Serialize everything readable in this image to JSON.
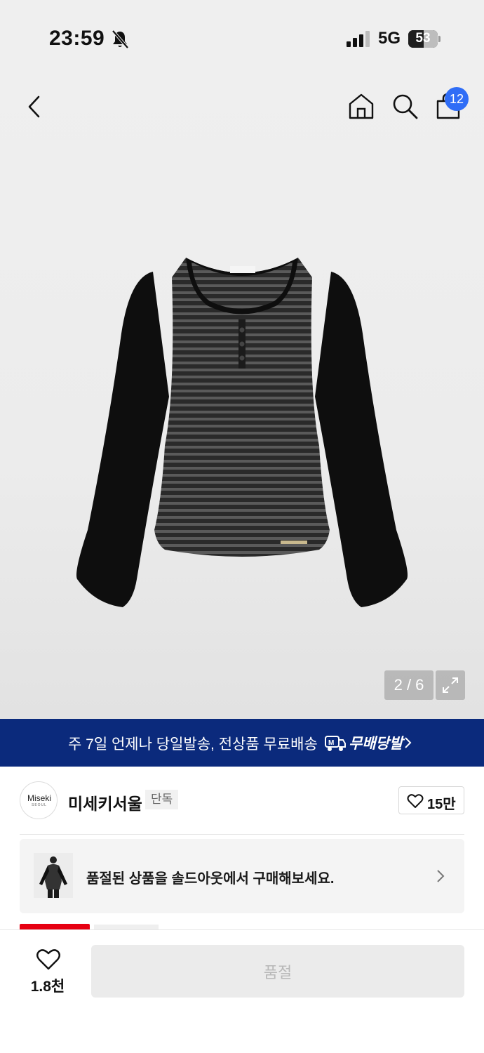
{
  "status_bar": {
    "time": "23:59",
    "network": "5G",
    "battery_level": 53,
    "battery_text": "53"
  },
  "nav": {
    "cart_count": "12"
  },
  "gallery": {
    "counter": "2 / 6",
    "current_image": 2,
    "total_images": 6
  },
  "promo": {
    "text": "주 7일 언제나 당일발송, 전상품 무료배송",
    "brand": "무배당발"
  },
  "brand": {
    "logo_text": "Miseki",
    "logo_subtext": "SEOUL",
    "name": "미세키서울",
    "exclusive_label": "단독",
    "like_count": "15만"
  },
  "soldout_card": {
    "text": "품절된 상품을 솔드아웃에서 구매해보세요."
  },
  "bottom_bar": {
    "like_count": "1.8천",
    "action_label": "품절"
  },
  "colors": {
    "banner_bg": "#0b2a7c",
    "badge_blue": "#2f6df6",
    "tag_red": "#e60012"
  }
}
